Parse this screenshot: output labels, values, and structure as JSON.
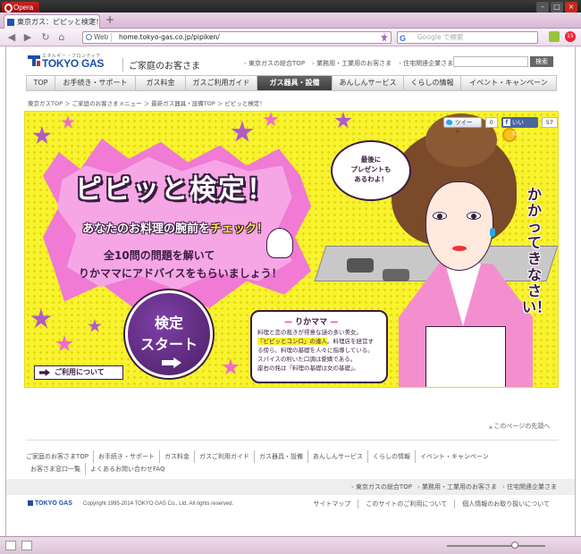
{
  "browser": {
    "menu_label": "Opera",
    "tab_title": "東京ガス：ピピッと検定！",
    "address_chip": "Web",
    "url": "home.tokyo-gas.co.jp/pipiken/",
    "search_engine": "Google",
    "search_placeholder": "Google で検索",
    "extension_badge": "15"
  },
  "header": {
    "logo_sub": "エネルギー・フロンティア",
    "logo_text": "TOKYO GAS",
    "site_name": "ご家庭のお客さま",
    "top_links": [
      "東京ガスの総合TOP",
      "業務用・工業用のお客さま",
      "住宅関連企業さま"
    ],
    "search_button": "検索"
  },
  "nav": {
    "items": [
      {
        "label": "TOP",
        "active": false
      },
      {
        "label": "お手続き・サポート",
        "active": false
      },
      {
        "label": "ガス料金",
        "active": false
      },
      {
        "label": "ガスご利用ガイド",
        "active": false
      },
      {
        "label": "ガス器具・設備",
        "active": true
      },
      {
        "label": "あんしんサービス",
        "active": false
      },
      {
        "label": "くらしの情報",
        "active": false
      },
      {
        "label": "イベント・キャンペーン",
        "active": false
      }
    ]
  },
  "breadcrumb": "東京ガスTOP ＞ ご家庭のお客さまメニュー ＞ 最新ガス器具・設備TOP ＞ ピピッと検定！",
  "banner": {
    "title": "ピピッと検定！",
    "subtitle_before": "あなたのお料理の腕前を",
    "subtitle_highlight": "チェック！",
    "desc_line1": "全10問の問題を解いて",
    "desc_line2": "りかママにアドバイスをもらいましょう！",
    "start_line1": "検定",
    "start_line2": "スタート",
    "speech_line1": "最後に",
    "speech_line2": "プレゼントも",
    "speech_line3": "あるわよ！",
    "vertical_text": "かかってきなさい！",
    "tweet_label": "ツイート",
    "tweet_count": "0",
    "like_label": "いいね！",
    "like_count": "57",
    "usage_button": "ご利用について",
    "profile": {
      "name": "りかママ",
      "line1": "料理と恋の裁きが得意な謎の多い美女。",
      "line2_hl": "『ピピッとコンロ』の達人",
      "line2_rest": "。料理店を経営す",
      "line3": "る傍ら、料理の基礎を人々に指導している。",
      "line4": "スパイスの利いた口調は愛嬌である。",
      "line5": "座右の銘は「料理の基礎は女の基礎」。"
    }
  },
  "page_top": "このページの先頭へ",
  "footer": {
    "links": [
      "ご家庭のお客さまTOP",
      "お手続き・サポート",
      "ガス料金",
      "ガスご利用ガイド",
      "ガス器具・設備",
      "あんしんサービス",
      "くらしの情報",
      "イベント・キャンペーン",
      "お客さま窓口一覧",
      "よくあるお問い合わせFAQ"
    ],
    "bar_links": [
      "東京ガスの総合TOP",
      "業務用・工業用のお客さま",
      "住宅関連企業さま"
    ],
    "logo": "TOKYO GAS",
    "copyright": "Copyright 1995-2014 TOKYO GAS Co., Ltd. All rights reserved.",
    "legal_links": [
      "サイトマップ",
      "このサイトのご利用について",
      "個人情報のお取り扱いについて"
    ]
  },
  "colors": {
    "brand_blue": "#1a4fa8",
    "banner_yellow": "#f8f230",
    "banner_pink": "#f07ad4",
    "banner_purple": "#4a1f66"
  }
}
